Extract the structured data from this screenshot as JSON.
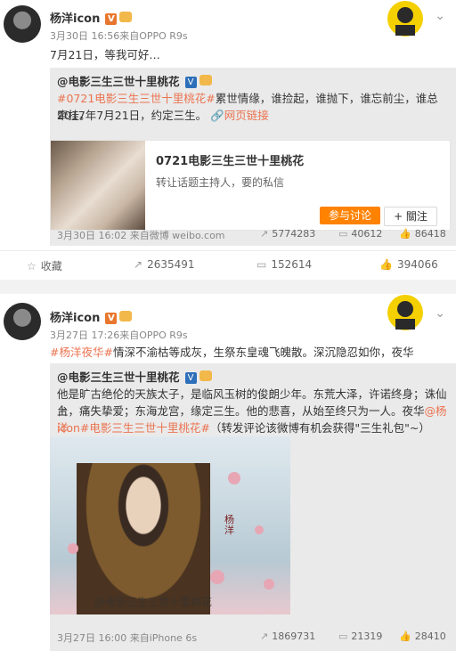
{
  "post1": {
    "username": "杨洋icon",
    "v_badge": "V",
    "time_source": "3月30日 16:56来自OPPO R9s",
    "text": "7月21日，等我可好…",
    "repost": {
      "line1_author": "@电影三生三世十里桃花",
      "line2_tag": "#0721电影三生三世十里桃花#",
      "line2_rest": "累世情缘，谁捡起，谁抛下，谁忘前尘，谁总牵挂。",
      "line3": "2017年7月21日，约定三生。",
      "web_link": "网页链接",
      "card_title": "0721电影三生三世十里桃花",
      "card_sub": "转让话题主持人，要的私信",
      "join_label": "参与讨论",
      "follow_label": "+ 關注",
      "footer_time": "3月30日 16:02 来自微博 weibo.com",
      "reposts": "5774283",
      "comments": "40612",
      "likes": "86418"
    },
    "actions": {
      "collect": "收藏",
      "repost": "2635491",
      "comment": "152614",
      "like": "394066"
    }
  },
  "post2": {
    "username": "杨洋icon",
    "v_badge": "V",
    "time_source": "3月27日 17:26来自OPPO R9s",
    "tag": "#杨洋夜华#",
    "text": "情深不渝枯等成灰，生祭东皇魂飞魄散。深沉隐忍如你，夜华",
    "repost": {
      "author": "@电影三生三世十里桃花",
      "line2": "他是旷古绝伦的天族太子，是临风玉树的俊朗少年。东荒大泽，许诺终身；诛仙台",
      "line3": "上，痛失挚爱；东海龙宫，缘定三生。他的悲喜，从始至终只为一人。夜华",
      "line3_mention": "@杨洋",
      "line4_mention": "icon",
      "line4_tag": "#电影三生三世十里桃花#",
      "line4_rest": "（转发评论该微博有机会获得\"三生礼包\"~）",
      "poster_watermark": "@电影三生三世十里桃花",
      "poster_name": "杨洋",
      "footer_time": "3月27日 16:00 来自iPhone 6s",
      "reposts": "1869731",
      "comments": "21319",
      "likes": "28410"
    }
  }
}
